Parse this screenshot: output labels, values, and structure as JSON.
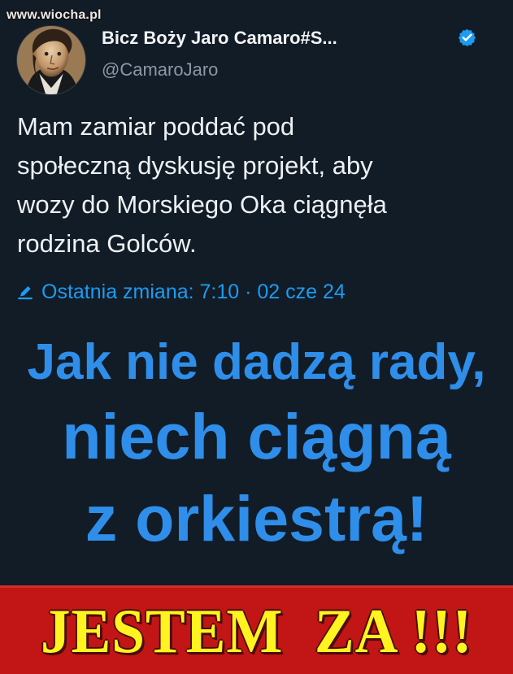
{
  "watermark": "www.wiocha.pl",
  "author": {
    "name": "Bicz Boży Jaro Camaro#S...",
    "handle": "@CamaroJaro",
    "avatar_icon": "portrait-avatar",
    "verified_icon": "verified-badge-icon"
  },
  "tweet": {
    "lines": [
      "Mam zamiar poddać pod",
      "społeczną dyskusję projekt, aby",
      "wozy do Morskiego Oka ciągnęła",
      "rodzina Golców."
    ],
    "edit_icon": "pencil-icon",
    "edited_label": "Ostatnia zmiana: 7:10 · 02 cze 24"
  },
  "quote": {
    "line1": "Jak nie dadzą rady,",
    "line2": "niech ciągną",
    "line3": "z orkiestrą!"
  },
  "banner": {
    "text": "JESTEM  ZA !!!"
  },
  "colors": {
    "background": "#111c27",
    "accent": "#1d9bf0",
    "quote": "#2f8ee9",
    "banner": "#c21516",
    "banner_text": "#fff41f"
  }
}
